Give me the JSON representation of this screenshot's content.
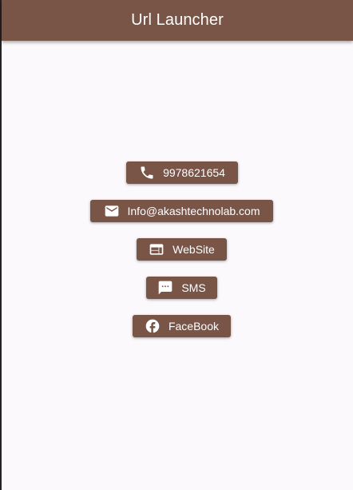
{
  "appbar": {
    "title": "Url Launcher"
  },
  "colors": {
    "primary": "#795548",
    "background": "#fbf9fb",
    "on_primary": "#ffffff"
  },
  "buttons": [
    {
      "label": "9978621654",
      "icon": "phone-icon"
    },
    {
      "label": "Info@akashtechnolab.com",
      "icon": "email-icon"
    },
    {
      "label": "WebSite",
      "icon": "web-icon"
    },
    {
      "label": "SMS",
      "icon": "sms-icon"
    },
    {
      "label": "FaceBook",
      "icon": "facebook-icon"
    }
  ]
}
